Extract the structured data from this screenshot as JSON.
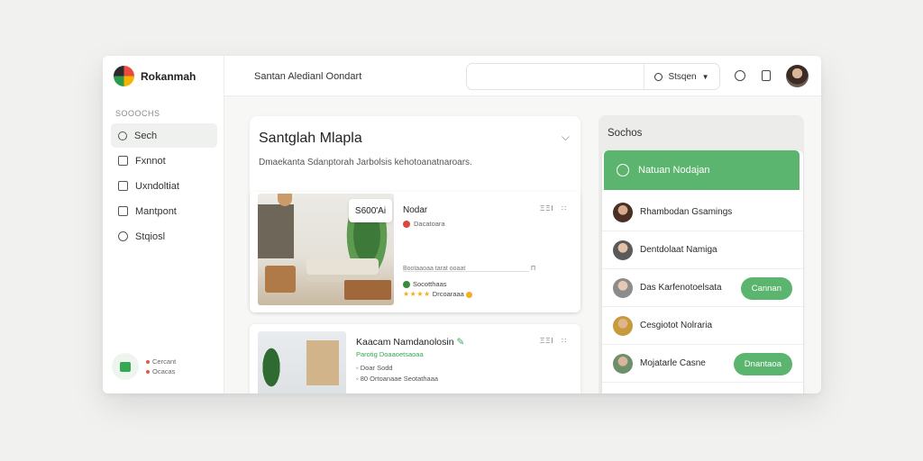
{
  "brand": {
    "name": "Rokanmah"
  },
  "sidebar": {
    "section_label": "SOOOCHS",
    "items": [
      {
        "label": "Sech",
        "icon": "search-icon"
      },
      {
        "label": "Fxnnot",
        "icon": "home-icon"
      },
      {
        "label": "Uxndoltiat",
        "icon": "folder-icon"
      },
      {
        "label": "Mantpont",
        "icon": "document-icon"
      },
      {
        "label": "Stqiosl",
        "icon": "clock-icon"
      }
    ],
    "footer": {
      "line1": "Cercant",
      "line2": "Ocacas"
    }
  },
  "header": {
    "title": "Santan Aledianl Oondart",
    "search_value": "",
    "search_button": "Stsqen"
  },
  "main": {
    "title": "Santglah Mlapla",
    "subtitle": "Dmaekanta Sdanptorah Jarbolsis kehotoanatnaroars.",
    "listings": [
      {
        "price": "S600'Ai",
        "title": "Nodar",
        "meta": "Dacatoara",
        "actions": [
          "ΞΞΙ",
          "∷"
        ],
        "line": "Bootaaoaa tarat  ooaat",
        "line_num": "Π",
        "agent": "Socotthaas",
        "reviews": "Drcoaraaa",
        "rating": 4
      },
      {
        "title": "Kaacam Namdanolosin",
        "green_text": "Parotig Doaaoetsaoaa",
        "meta1": "Doar Sodd",
        "meta2": "80 Ortoanaae Seotathaaa",
        "actions": [
          "ΞΞΙ",
          "∷"
        ]
      }
    ]
  },
  "panel": {
    "title": "Sochos",
    "head": "Natuan Nodajan",
    "rows": [
      {
        "name": "Rhambodan Gsamings",
        "button": ""
      },
      {
        "name": "Dentdolaat Namiga",
        "button": ""
      },
      {
        "name": "Das Karfenotoelsata",
        "button": "Cannan"
      },
      {
        "name": "Cesgiotot Nolraria",
        "button": ""
      },
      {
        "name": "Mojatarle Casne",
        "button": "Dnantaoa"
      }
    ]
  },
  "colors": {
    "accent": "#5cb56e",
    "red": "#e0453a",
    "star": "#f2b01e"
  }
}
